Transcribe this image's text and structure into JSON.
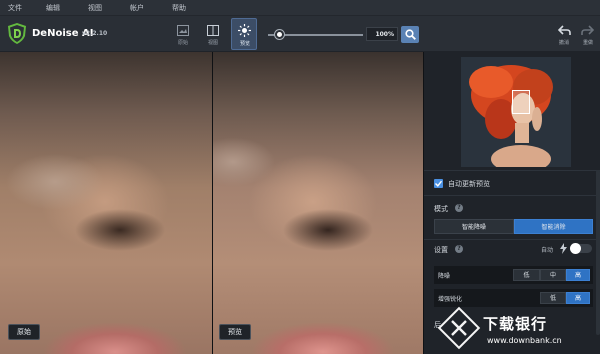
{
  "menu": {
    "items": [
      "文件",
      "编辑",
      "视图",
      "帐户",
      "帮助"
    ]
  },
  "app": {
    "name": "DeNoise AI",
    "version": "v2.2.10"
  },
  "toolbar": {
    "view_modes": [
      {
        "label": "原始",
        "active": false
      },
      {
        "label": "视图",
        "active": false
      },
      {
        "label": "预览",
        "active": true
      }
    ],
    "zoom": "100%",
    "undo_label": "撤消",
    "redo_label": "重做",
    "slider_value": 0.12
  },
  "images": {
    "left_tag": "原始",
    "right_tag": "预览"
  },
  "panel": {
    "auto_update_label": "自动更新预览",
    "auto_update_checked": true,
    "mode_title": "模式",
    "mode_options": [
      "智能降噪",
      "智能消除"
    ],
    "mode_selected": 1,
    "settings_title": "设置",
    "auto_label": "自动",
    "rows": [
      {
        "label": "降噪",
        "options": [
          "低",
          "中",
          "高"
        ],
        "selected": 2
      },
      {
        "label": "增强锐化",
        "options": [
          "低",
          "高"
        ],
        "selected": 1
      }
    ],
    "partial_label": "后"
  },
  "watermark": {
    "brand": "下载银行",
    "url": "www.downbank.cn"
  },
  "colors": {
    "accent": "#2f73c4",
    "panel_bg": "#1f2329",
    "toolbar_bg": "#2a2f36"
  }
}
